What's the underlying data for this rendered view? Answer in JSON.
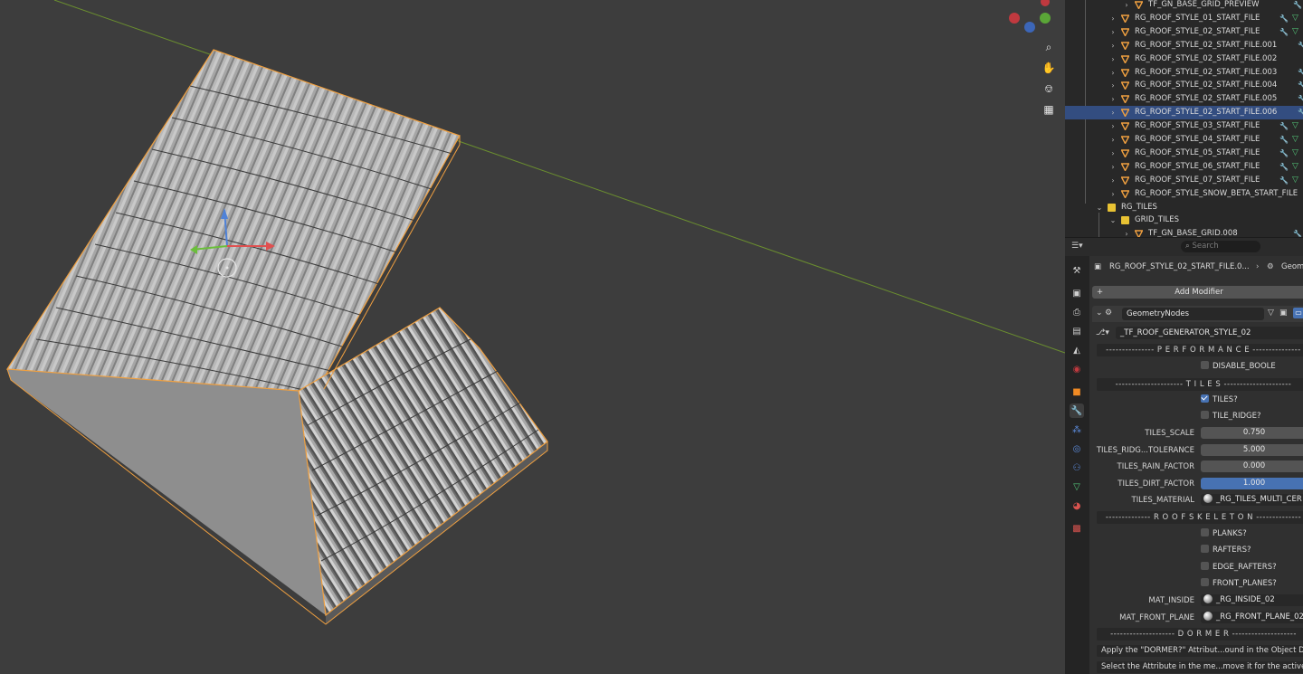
{
  "outliner": {
    "rows": [
      {
        "label": "TF_GN_BASE_GRID_PREVIEW",
        "type": "object",
        "indent": 3,
        "selected": false,
        "modifier": true
      },
      {
        "label": "RG_ROOF_STYLE_01_START_FILE",
        "type": "object",
        "indent": 2,
        "selected": false,
        "modifier": true
      },
      {
        "label": "RG_ROOF_STYLE_02_START_FILE",
        "type": "object",
        "indent": 2,
        "selected": false,
        "modifier": true
      },
      {
        "label": "RG_ROOF_STYLE_02_START_FILE.001",
        "type": "object",
        "indent": 2,
        "selected": false,
        "modifier": true
      },
      {
        "label": "RG_ROOF_STYLE_02_START_FILE.002",
        "type": "object",
        "indent": 2,
        "selected": false,
        "modifier": false
      },
      {
        "label": "RG_ROOF_STYLE_02_START_FILE.003",
        "type": "object",
        "indent": 2,
        "selected": false,
        "modifier": true
      },
      {
        "label": "RG_ROOF_STYLE_02_START_FILE.004",
        "type": "object",
        "indent": 2,
        "selected": false,
        "modifier": true
      },
      {
        "label": "RG_ROOF_STYLE_02_START_FILE.005",
        "type": "object",
        "indent": 2,
        "selected": false,
        "modifier": true
      },
      {
        "label": "RG_ROOF_STYLE_02_START_FILE.006",
        "type": "object",
        "indent": 2,
        "selected": true,
        "modifier": true
      },
      {
        "label": "RG_ROOF_STYLE_03_START_FILE",
        "type": "object",
        "indent": 2,
        "selected": false,
        "modifier": true
      },
      {
        "label": "RG_ROOF_STYLE_04_START_FILE",
        "type": "object",
        "indent": 2,
        "selected": false,
        "modifier": true
      },
      {
        "label": "RG_ROOF_STYLE_05_START_FILE",
        "type": "object",
        "indent": 2,
        "selected": false,
        "modifier": true
      },
      {
        "label": "RG_ROOF_STYLE_06_START_FILE",
        "type": "object",
        "indent": 2,
        "selected": false,
        "modifier": true
      },
      {
        "label": "RG_ROOF_STYLE_07_START_FILE",
        "type": "object",
        "indent": 2,
        "selected": false,
        "modifier": true
      },
      {
        "label": "RG_ROOF_STYLE_SNOW_BETA_START_FILE",
        "type": "object",
        "indent": 2,
        "selected": false,
        "modifier": false
      },
      {
        "label": "RG_TILES",
        "type": "collection",
        "indent": 1,
        "selected": false,
        "modifier": false
      },
      {
        "label": "GRID_TILES",
        "type": "collection",
        "indent": 2,
        "selected": false,
        "modifier": false
      },
      {
        "label": "TF_GN_BASE_GRID.008",
        "type": "object",
        "indent": 3,
        "selected": false,
        "modifier": true
      }
    ]
  },
  "props_header": {
    "search_placeholder": "Search",
    "breadcrumb_object": "RG_ROOF_STYLE_02_START_FILE.0...",
    "breadcrumb_modifier": "Geom"
  },
  "modifier": {
    "add_label": "Add Modifier",
    "name": "GeometryNodes",
    "node_group": "_TF_ROOF_GENERATOR_STYLE_02"
  },
  "sections": {
    "performance": "--------------- P E R F O R M A N C E ---------------",
    "tiles": "--------------------- T I L E S ---------------------",
    "skeleton": "-------------- R O O F   S K E L E T O N --------------",
    "dormer": "-------------------- D O R M E R --------------------"
  },
  "checkboxes": {
    "disable_boole": {
      "label": "DISABLE_BOOLE",
      "checked": false
    },
    "tiles": {
      "label": "TILES?",
      "checked": true
    },
    "tile_ridge": {
      "label": "TILE_RIDGE?",
      "checked": false
    },
    "planks": {
      "label": "PLANKS?",
      "checked": false
    },
    "rafters": {
      "label": "RAFTERS?",
      "checked": false
    },
    "edge_rafters": {
      "label": "EDGE_RAFTERS?",
      "checked": false
    },
    "front_planes": {
      "label": "FRONT_PLANES?",
      "checked": false
    }
  },
  "fields": {
    "tiles_scale": {
      "label": "TILES_SCALE",
      "value": "0.750"
    },
    "tiles_ridge_tol": {
      "label": "TILES_RIDG...TOLERANCE",
      "value": "5.000"
    },
    "tiles_rain": {
      "label": "TILES_RAIN_FACTOR",
      "value": "0.000"
    },
    "tiles_dirt": {
      "label": "TILES_DIRT_FACTOR",
      "value": "1.000"
    }
  },
  "materials": {
    "tiles_material": {
      "label": "TILES_MATERIAL",
      "value": "_RG_TILES_MULTI_CER"
    },
    "mat_inside": {
      "label": "MAT_INSIDE",
      "value": "_RG_INSIDE_02"
    },
    "mat_front_plane": {
      "label": "MAT_FRONT_PLANE",
      "value": "_RG_FRONT_PLANE_02"
    }
  },
  "info": {
    "line1": "Apply the \"DORMER?\" Attribut...ound in the Object Dat",
    "line2": "Select the Attribute in the me...move it for the active se"
  },
  "colors": {
    "viewport_bg": "#3d3d3d",
    "selection_outline": "#f0a040",
    "accent_blue": "#4772b3",
    "outliner_selected": "#334d80"
  }
}
